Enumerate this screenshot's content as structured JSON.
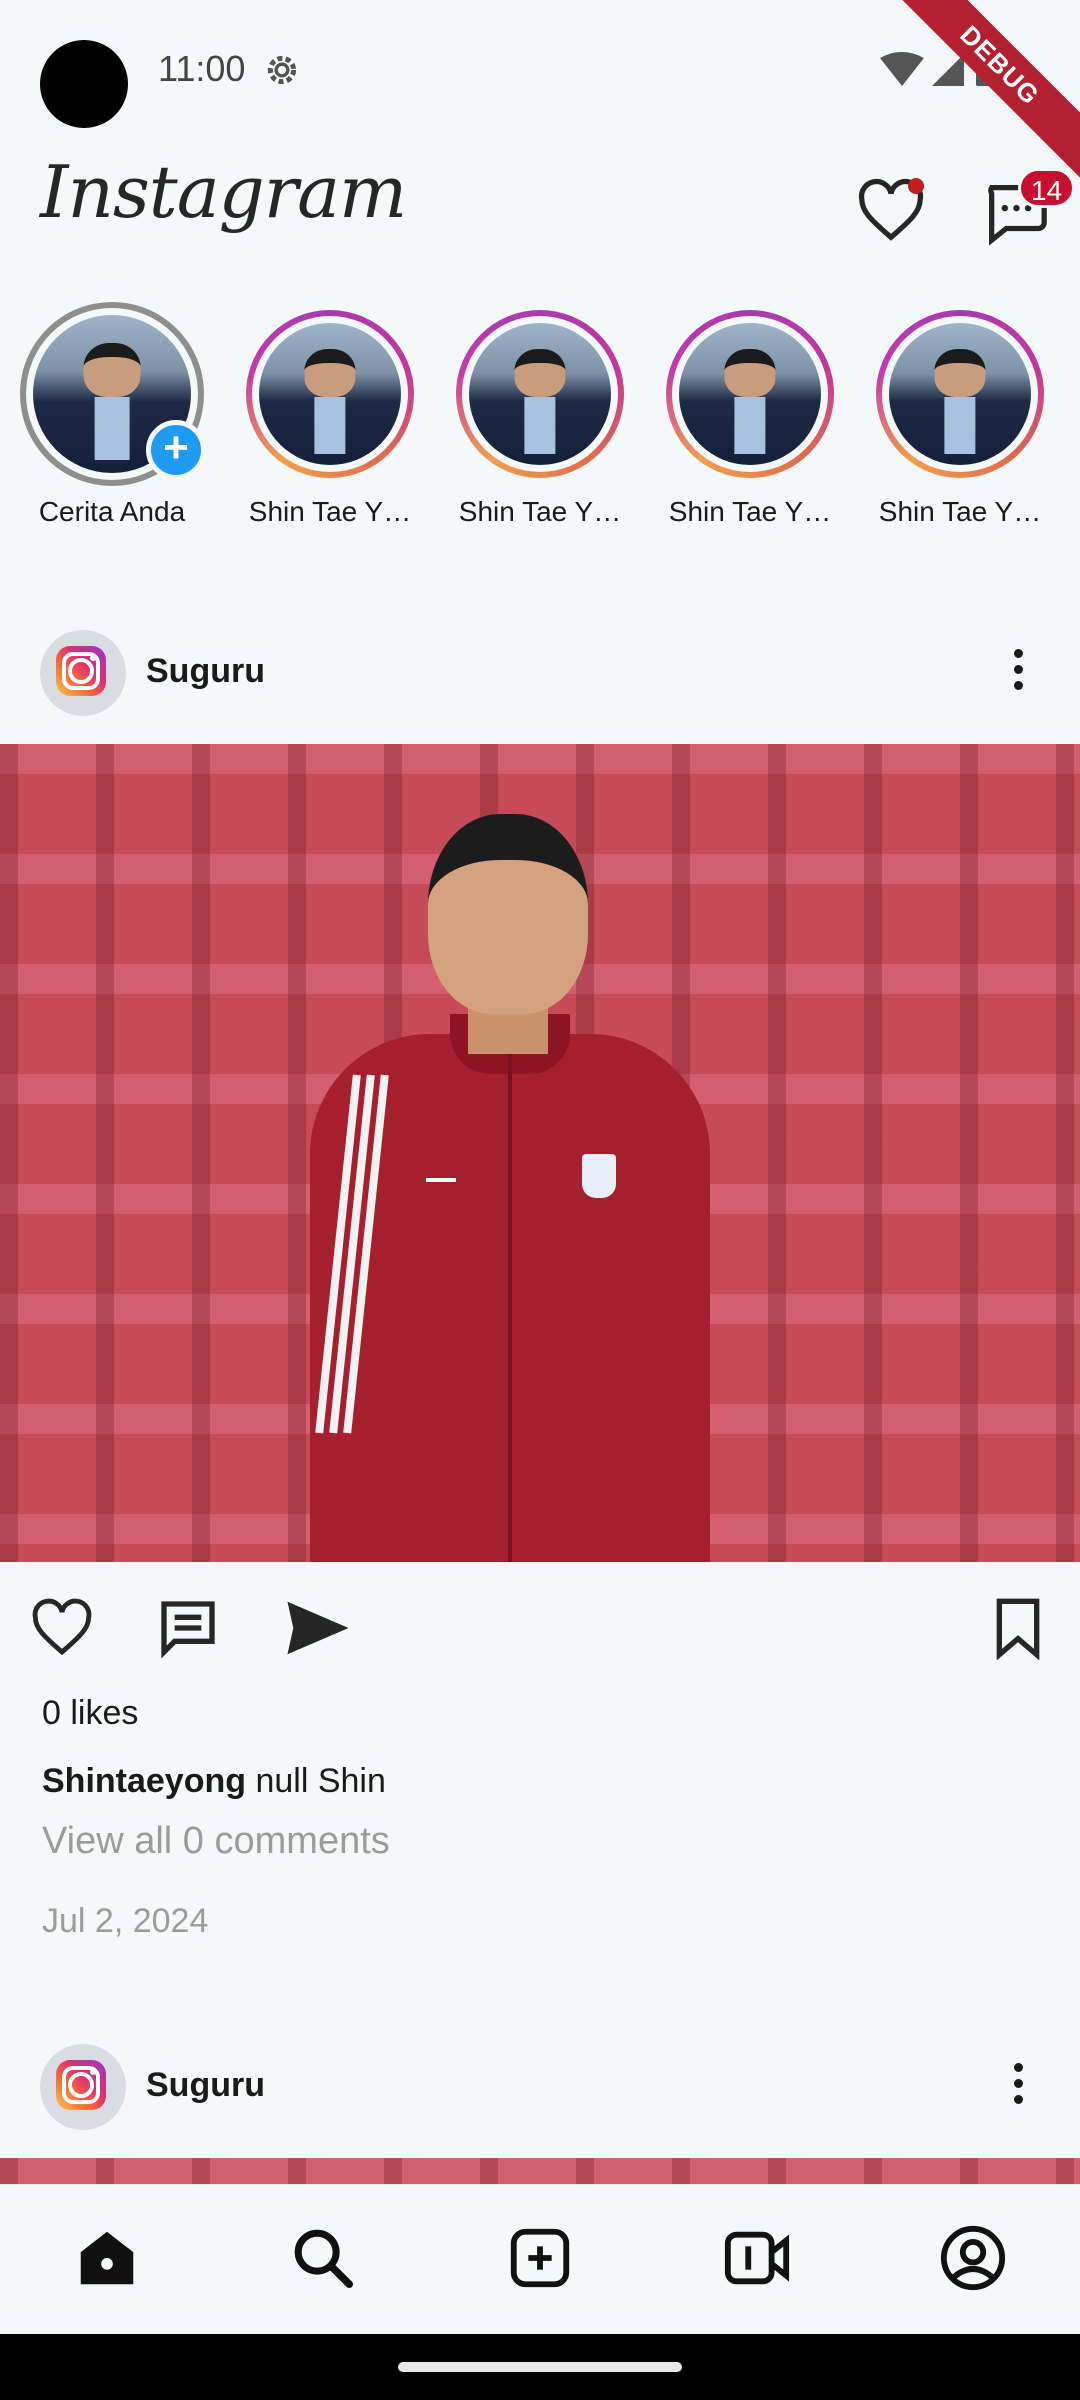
{
  "status_bar": {
    "time": "11:00",
    "debug_label": "DEBUG"
  },
  "header": {
    "logo": "Instagram",
    "message_badge": "14"
  },
  "stories": [
    {
      "label": "Cerita Anda",
      "own": true
    },
    {
      "label": "Shin Tae Y…",
      "own": false
    },
    {
      "label": "Shin Tae Y…",
      "own": false
    },
    {
      "label": "Shin Tae Y…",
      "own": false
    },
    {
      "label": "Shin Tae Y…",
      "own": false
    }
  ],
  "posts": [
    {
      "username": "Suguru",
      "likes": "0 likes",
      "caption_user": "Shintaeyong",
      "caption_text": " null Shin",
      "view_comments": "View all 0 comments",
      "date": "Jul 2, 2024"
    },
    {
      "username": "Suguru"
    }
  ],
  "icons": {
    "status": [
      "settings-gear-icon",
      "wifi-icon",
      "signal-icon",
      "battery-icon"
    ],
    "header": [
      "heart-icon",
      "messenger-icon"
    ],
    "post_actions": [
      "like-heart-icon",
      "comment-icon",
      "share-send-icon",
      "bookmark-icon"
    ],
    "bottom_nav": [
      "home-icon",
      "search-icon",
      "add-post-icon",
      "reels-icon",
      "profile-icon"
    ]
  },
  "colors": {
    "background": "#f4f8f8",
    "badge": "#c8102e",
    "story_add": "#1e9bf0"
  }
}
